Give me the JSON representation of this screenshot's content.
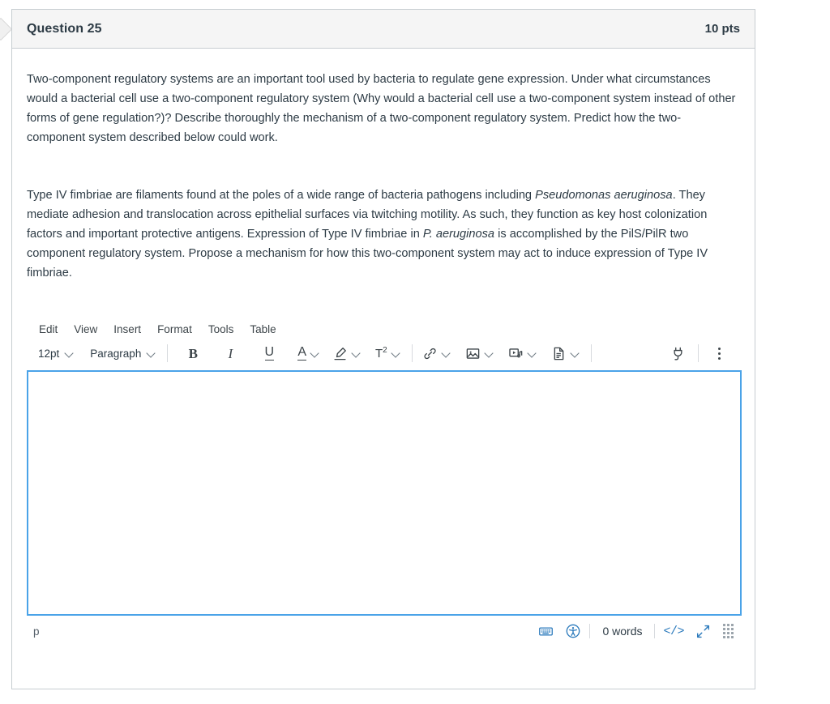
{
  "question": {
    "title": "Question 25",
    "points": "10 pts",
    "paragraphs": [
      {
        "runs": [
          {
            "text": "Two-component regulatory systems are an important tool used by bacteria to regulate gene expression.  Under what circumstances would a bacterial cell use a two-component regulatory system (Why would a bacterial cell use a two-component system instead of other forms of gene regulation?)?  Describe thoroughly the mechanism of a two-component regulatory system.  Predict how the two-component system described below could work.",
            "italic": false
          }
        ]
      },
      {
        "runs": [
          {
            "text": "Type IV fimbriae are filaments found at the poles of a wide range of bacteria pathogens including ",
            "italic": false
          },
          {
            "text": "Pseudomonas aeruginosa",
            "italic": true
          },
          {
            "text": ".  They mediate adhesion and translocation across epithelial surfaces via twitching motility.  As such, they function as key host colonization factors and important protective antigens.  Expression of Type IV fimbriae in ",
            "italic": false
          },
          {
            "text": "P. aeruginosa",
            "italic": true
          },
          {
            "text": " is accomplished by the PilS/PilR two component regulatory system.  Propose a mechanism for how this two-component system may act to induce expression of Type IV fimbriae.",
            "italic": false
          }
        ]
      }
    ]
  },
  "editor": {
    "menubar": [
      {
        "label": "Edit",
        "name": "menu-edit"
      },
      {
        "label": "View",
        "name": "menu-view"
      },
      {
        "label": "Insert",
        "name": "menu-insert"
      },
      {
        "label": "Format",
        "name": "menu-format"
      },
      {
        "label": "Tools",
        "name": "menu-tools"
      },
      {
        "label": "Table",
        "name": "menu-table"
      }
    ],
    "toolbar": {
      "font_size": "12pt",
      "block_format": "Paragraph",
      "bold_label": "B",
      "italic_label": "I",
      "underline_label": "U",
      "text_color_label": "A",
      "superscript_label": "T",
      "superscript_exponent": "2"
    },
    "statusbar": {
      "element_path": "p",
      "word_count": "0 words",
      "html_editor_label": "</>"
    },
    "content_value": "",
    "accent_color": "#2b7abc",
    "focus_border_color": "#4aa3e8"
  }
}
